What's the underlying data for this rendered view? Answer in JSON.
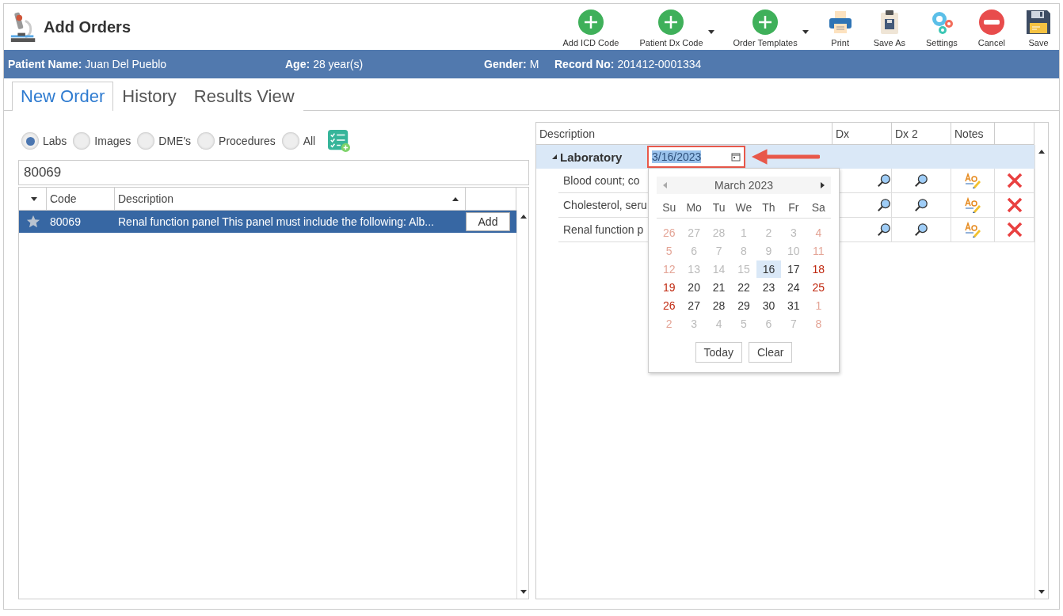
{
  "window": {
    "title": "Add Orders"
  },
  "toolbar": [
    {
      "label": "Add ICD Code",
      "kind": "add",
      "dropdown": false
    },
    {
      "label": "Patient Dx Code",
      "kind": "add",
      "dropdown": true
    },
    {
      "label": "Order Templates",
      "kind": "add",
      "dropdown": true
    },
    {
      "label": "Print",
      "kind": "print",
      "dropdown": false
    },
    {
      "label": "Save As",
      "kind": "save-as",
      "dropdown": false
    },
    {
      "label": "Settings",
      "kind": "settings",
      "dropdown": false
    },
    {
      "label": "Cancel",
      "kind": "cancel",
      "dropdown": false
    },
    {
      "label": "Save",
      "kind": "save",
      "dropdown": false
    }
  ],
  "patient": [
    {
      "label": "Patient Name:",
      "value": "Juan Del Pueblo"
    },
    {
      "label": "Age:",
      "value": "28 year(s)"
    },
    {
      "label": "Gender:",
      "value": "M"
    },
    {
      "label": "Record No:",
      "value": "201412-0001334"
    }
  ],
  "tabs": [
    {
      "label": "New Order",
      "selected": true
    },
    {
      "label": "History",
      "selected": false
    },
    {
      "label": "Results View",
      "selected": false
    }
  ],
  "filters": [
    {
      "label": "Labs",
      "selected": true
    },
    {
      "label": "Images",
      "selected": false
    },
    {
      "label": "DME's",
      "selected": false
    },
    {
      "label": "Procedures",
      "selected": false
    },
    {
      "label": "All",
      "selected": false
    }
  ],
  "search": {
    "value": "80069"
  },
  "code_table": {
    "columns": [
      "Code",
      "Description"
    ],
    "rows": [
      {
        "code": "80069",
        "description": "Renal function panel This panel must include the following: Alb...",
        "selected": true,
        "button": "Add"
      }
    ]
  },
  "order_table": {
    "columns": [
      "Description",
      "Dx",
      "Dx 2",
      "Notes"
    ],
    "group": {
      "label": "Laboratory",
      "expanded": true,
      "date": "3/16/2023"
    },
    "rows": [
      {
        "description": "Blood count; co"
      },
      {
        "description": "Cholesterol, seru"
      },
      {
        "description": "Renal function p"
      }
    ]
  },
  "calendar": {
    "month": "March 2023",
    "weekdays": [
      "Su",
      "Mo",
      "Tu",
      "We",
      "Th",
      "Fr",
      "Sa"
    ],
    "weeks": [
      [
        {
          "day": "26",
          "muted": true,
          "selected": false
        },
        {
          "day": "27",
          "muted": true,
          "selected": false
        },
        {
          "day": "28",
          "muted": true,
          "selected": false
        },
        {
          "day": "1",
          "muted": true,
          "selected": false
        },
        {
          "day": "2",
          "muted": true,
          "selected": false
        },
        {
          "day": "3",
          "muted": true,
          "selected": false
        },
        {
          "day": "4",
          "muted": true,
          "selected": false
        }
      ],
      [
        {
          "day": "5",
          "muted": true,
          "selected": false
        },
        {
          "day": "6",
          "muted": true,
          "selected": false
        },
        {
          "day": "7",
          "muted": true,
          "selected": false
        },
        {
          "day": "8",
          "muted": true,
          "selected": false
        },
        {
          "day": "9",
          "muted": true,
          "selected": false
        },
        {
          "day": "10",
          "muted": true,
          "selected": false
        },
        {
          "day": "11",
          "muted": true,
          "selected": false
        }
      ],
      [
        {
          "day": "12",
          "muted": true,
          "selected": false
        },
        {
          "day": "13",
          "muted": true,
          "selected": false
        },
        {
          "day": "14",
          "muted": true,
          "selected": false
        },
        {
          "day": "15",
          "muted": true,
          "selected": false
        },
        {
          "day": "16",
          "muted": false,
          "selected": true
        },
        {
          "day": "17",
          "muted": false,
          "selected": false
        },
        {
          "day": "18",
          "muted": false,
          "selected": false
        }
      ],
      [
        {
          "day": "19",
          "muted": false,
          "selected": false
        },
        {
          "day": "20",
          "muted": false,
          "selected": false
        },
        {
          "day": "21",
          "muted": false,
          "selected": false
        },
        {
          "day": "22",
          "muted": false,
          "selected": false
        },
        {
          "day": "23",
          "muted": false,
          "selected": false
        },
        {
          "day": "24",
          "muted": false,
          "selected": false
        },
        {
          "day": "25",
          "muted": false,
          "selected": false
        }
      ],
      [
        {
          "day": "26",
          "muted": false,
          "selected": false
        },
        {
          "day": "27",
          "muted": false,
          "selected": false
        },
        {
          "day": "28",
          "muted": false,
          "selected": false
        },
        {
          "day": "29",
          "muted": false,
          "selected": false
        },
        {
          "day": "30",
          "muted": false,
          "selected": false
        },
        {
          "day": "31",
          "muted": false,
          "selected": false
        },
        {
          "day": "1",
          "muted": true,
          "selected": false
        }
      ],
      [
        {
          "day": "2",
          "muted": true,
          "selected": false
        },
        {
          "day": "3",
          "muted": true,
          "selected": false
        },
        {
          "day": "4",
          "muted": true,
          "selected": false
        },
        {
          "day": "5",
          "muted": true,
          "selected": false
        },
        {
          "day": "6",
          "muted": true,
          "selected": false
        },
        {
          "day": "7",
          "muted": true,
          "selected": false
        },
        {
          "day": "8",
          "muted": true,
          "selected": false
        }
      ]
    ],
    "buttons": [
      "Today",
      "Clear"
    ]
  }
}
